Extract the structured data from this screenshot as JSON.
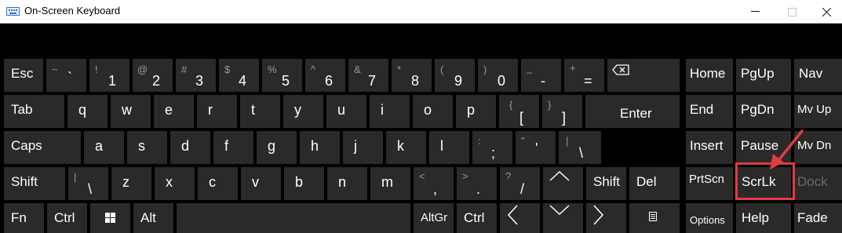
{
  "window": {
    "title": "On-Screen Keyboard",
    "minimize": "—",
    "close": "✕"
  },
  "row1": {
    "esc": "Esc",
    "k1": {
      "sub": "!",
      "main": "1"
    },
    "k2": {
      "sub": "@",
      "main": "2"
    },
    "k3": {
      "sub": "#",
      "main": "3"
    },
    "k4": {
      "sub": "$",
      "main": "4"
    },
    "k5": {
      "sub": "%",
      "main": "5"
    },
    "k6": {
      "sub": "^",
      "main": "6"
    },
    "k7": {
      "sub": "&",
      "main": "7"
    },
    "k8": {
      "sub": "*",
      "main": "8"
    },
    "k9": {
      "sub": "(",
      "main": "9"
    },
    "k0": {
      "sub": ")",
      "main": "0"
    },
    "minus": {
      "sub": "_",
      "main": "-"
    },
    "equals": {
      "sub": "+",
      "main": "="
    },
    "tilde": {
      "sub": "~",
      "main": "`"
    }
  },
  "row2": {
    "tab": "Tab",
    "keys": [
      "q",
      "w",
      "e",
      "r",
      "t",
      "y",
      "u",
      "i",
      "o",
      "p"
    ],
    "lbracket": {
      "sub": "{",
      "main": "["
    },
    "rbracket": {
      "sub": "}",
      "main": "]"
    },
    "enter": "Enter"
  },
  "row3": {
    "caps": "Caps",
    "keys": [
      "a",
      "s",
      "d",
      "f",
      "g",
      "h",
      "j",
      "k",
      "l"
    ],
    "semicolon": {
      "sub": ":",
      "main": ";"
    },
    "quote": {
      "sub": "\"",
      "main": "'"
    },
    "backslash": {
      "sub": "|",
      "main": "\\"
    }
  },
  "row4": {
    "shift": "Shift",
    "backslash": {
      "sub": "|",
      "main": "\\"
    },
    "keys": [
      "z",
      "x",
      "c",
      "v",
      "b",
      "n",
      "m"
    ],
    "comma": {
      "sub": "<",
      "main": ","
    },
    "period": {
      "sub": ">",
      "main": "."
    },
    "slash": {
      "sub": "?",
      "main": "/"
    },
    "rshift": "Shift",
    "del": "Del"
  },
  "row5": {
    "fn": "Fn",
    "ctrl": "Ctrl",
    "alt": "Alt",
    "altgr": "AltGr",
    "rctrl": "Ctrl"
  },
  "nav": {
    "home": "Home",
    "pgup": "PgUp",
    "nav": "Nav",
    "end": "End",
    "pgdn": "PgDn",
    "mvup": "Mv Up",
    "insert": "Insert",
    "pause": "Pause",
    "mvdn": "Mv Dn",
    "prtscn": "PrtScn",
    "scrlk": "ScrLk",
    "dock": "Dock",
    "options": "Options",
    "help": "Help",
    "fade": "Fade"
  },
  "colors": {
    "key": "#2a2a2a",
    "background": "#000000",
    "highlight": "#e13b43",
    "disabled_text": "#6c6c6c"
  }
}
